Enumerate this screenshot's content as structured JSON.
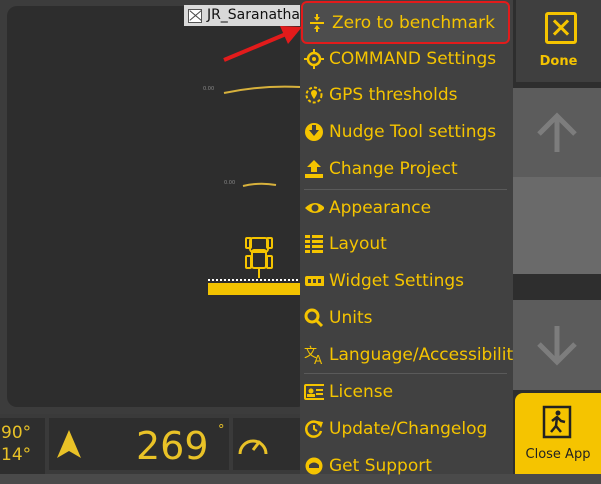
{
  "map": {
    "tab_label": "JR_Saranatha",
    "small_label_top": "0.00",
    "small_label_mid": "0.00"
  },
  "status_bar": {
    "angle_1": "90°",
    "angle_2": "14°",
    "heading_value": "269",
    "heading_unit": "°"
  },
  "menu": {
    "items": [
      {
        "label": "Zero to benchmark",
        "icon": "zero-benchmark-icon"
      },
      {
        "label": "COMMAND Settings",
        "icon": "crosshair-icon"
      },
      {
        "label": "GPS thresholds",
        "icon": "gps-pin-icon"
      },
      {
        "label": "Nudge Tool settings",
        "icon": "nudge-icon"
      },
      {
        "label": "Change Project",
        "icon": "upload-icon"
      },
      {
        "label": "Appearance",
        "icon": "eye-icon"
      },
      {
        "label": "Layout",
        "icon": "layout-icon"
      },
      {
        "label": "Widget Settings",
        "icon": "widget-icon"
      },
      {
        "label": "Units",
        "icon": "units-icon"
      },
      {
        "label": "Language/Accessibility",
        "icon": "translate-icon"
      },
      {
        "label": "License",
        "icon": "license-icon"
      },
      {
        "label": "Update/Changelog",
        "icon": "update-icon"
      },
      {
        "label": "Get Support",
        "icon": "support-icon"
      }
    ]
  },
  "right_panel": {
    "done_label": "Done",
    "close_label": "Close App"
  },
  "colors": {
    "accent": "#f5c400",
    "highlight_border": "#e21b1b",
    "menu_bg": "#414141"
  }
}
